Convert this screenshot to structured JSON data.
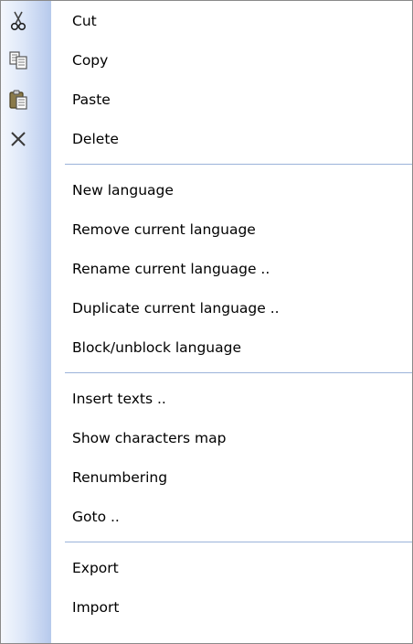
{
  "menu": {
    "groups": [
      {
        "items": [
          {
            "label": "Cut",
            "icon": "scissors-icon"
          },
          {
            "label": "Copy",
            "icon": "copy-icon"
          },
          {
            "label": "Paste",
            "icon": "paste-icon"
          },
          {
            "label": "Delete",
            "icon": "delete-x-icon"
          }
        ]
      },
      {
        "items": [
          {
            "label": "New language"
          },
          {
            "label": "Remove current language"
          },
          {
            "label": "Rename current language .."
          },
          {
            "label": "Duplicate current language .."
          },
          {
            "label": "Block/unblock language"
          }
        ]
      },
      {
        "items": [
          {
            "label": "Insert texts .."
          },
          {
            "label": "Show characters map"
          },
          {
            "label": "Renumbering"
          },
          {
            "label": "Goto .."
          }
        ]
      },
      {
        "items": [
          {
            "label": "Export"
          },
          {
            "label": "Import"
          }
        ]
      }
    ]
  },
  "colors": {
    "gutter_light": "#f4f7fd",
    "gutter_dark": "#b6c9ec",
    "separator": "#9bb3da",
    "text": "#000000"
  }
}
